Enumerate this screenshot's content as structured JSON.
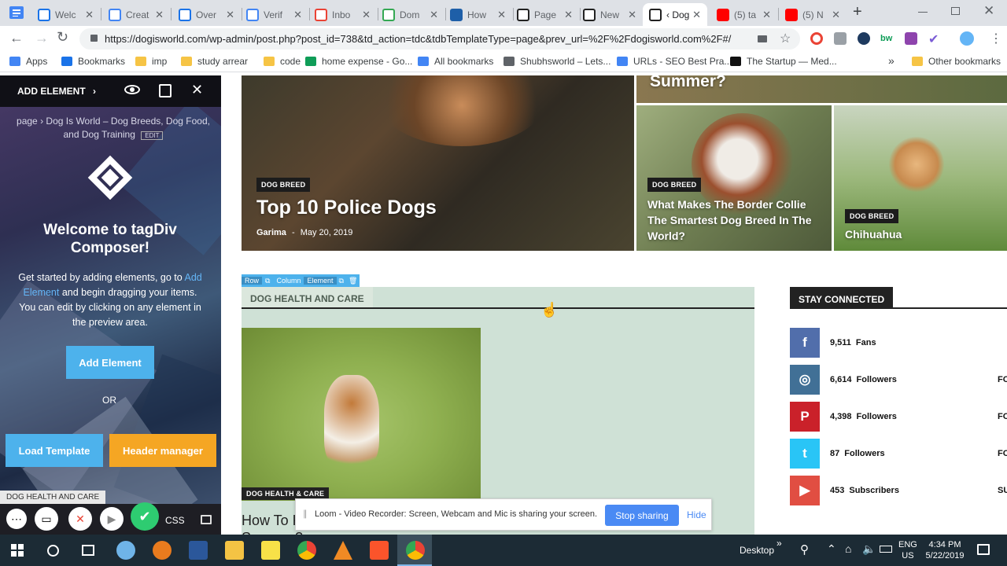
{
  "browser": {
    "tabs": [
      {
        "title": "Welc",
        "fav_color": "#ffffff",
        "fav_border": "#1a73e8",
        "icon": "wordpress-icon"
      },
      {
        "title": "Creat",
        "fav_color": "#ffffff",
        "fav_border": "#4285f4",
        "icon": "web-icon"
      },
      {
        "title": "Over",
        "fav_color": "#ffffff",
        "fav_border": "#1a73e8",
        "icon": "wordpress-icon"
      },
      {
        "title": "Verif",
        "fav_color": "#ffffff",
        "fav_border": "#4285f4",
        "icon": "google-icon"
      },
      {
        "title": "Inbo",
        "fav_color": "#ffffff",
        "fav_border": "#ea4335",
        "icon": "gmail-icon"
      },
      {
        "title": "Dom",
        "fav_color": "#ffffff",
        "fav_border": "#34a853",
        "icon": "domain-icon"
      },
      {
        "title": "How",
        "fav_color": "#1e5fa8",
        "fav_border": "#1e5fa8",
        "icon": "gear-icon"
      },
      {
        "title": "Page",
        "fav_color": "#ffffff",
        "fav_border": "#222222",
        "icon": "panda-icon"
      },
      {
        "title": "New",
        "fav_color": "#ffffff",
        "fav_border": "#222222",
        "icon": "tagdiv-icon"
      },
      {
        "title": "‹ Dog",
        "fav_color": "#ffffff",
        "fav_border": "#222222",
        "icon": "panda-icon",
        "active": true
      },
      {
        "title": "(5) ta",
        "fav_color": "#ff0000",
        "fav_border": "#ff0000",
        "icon": "youtube-icon"
      },
      {
        "title": "(5) N",
        "fav_color": "#ff0000",
        "fav_border": "#ff0000",
        "icon": "youtube-icon"
      }
    ],
    "new_tab": "+",
    "url": "https://dogisworld.com/wp-admin/post.php?post_id=738&td_action=tdc&tdbTemplateType=page&prev_url=%2F%2Fdogisworld.com%2F#/",
    "bookmarks": [
      {
        "label": "Apps",
        "color": "#4285f4"
      },
      {
        "label": "Bookmarks",
        "color": "#1a73e8"
      },
      {
        "label": "imp",
        "color": "#f6c445"
      },
      {
        "label": "study arrear",
        "color": "#f6c445"
      },
      {
        "label": "code",
        "color": "#f6c445"
      },
      {
        "label": "home expense - Go...",
        "color": "#0f9d58"
      },
      {
        "label": "All bookmarks",
        "color": "#4285f4"
      },
      {
        "label": "Shubhsworld – Lets...",
        "color": "#5f6368"
      },
      {
        "label": "URLs - SEO Best Pra...",
        "color": "#4285f4"
      },
      {
        "label": "The Startup — Med...",
        "color": "#111111"
      }
    ],
    "more": "»",
    "other_bookmarks": "Other bookmarks"
  },
  "sidebar": {
    "add_element": "ADD ELEMENT",
    "breadcrumb_page": "page",
    "breadcrumb_title": "Dog Is World – Dog Breeds, Dog Food, and Dog Training",
    "edit_label": "EDIT",
    "welcome": "Welcome to tagDiv Composer!",
    "intro_start": "Get started by adding elements, go to",
    "intro_link": "Add Element",
    "intro_end": "and begin dragging your items. You can edit by clicking on any element in the preview area.",
    "add_button": "Add Element",
    "or": "OR",
    "load_template": "Load Template",
    "header_manager": "Header manager",
    "status_label": "DOG HEALTH AND CARE",
    "css_label": "CSS"
  },
  "main": {
    "tile_top_right_title": "Summer?",
    "tile1": {
      "badge": "DOG BREED",
      "title": "Top 10 Police Dogs",
      "author": "Garima",
      "sep": "-",
      "date": "May 20, 2019"
    },
    "tile2": {
      "badge": "DOG BREED",
      "title": "What Makes The Border Collie The Smartest Dog Breed In The World?"
    },
    "tile3": {
      "badge": "DOG BREED",
      "title": "Chihuahua"
    },
    "editor_toolbar": {
      "row": "Row",
      "column": "Column",
      "element": "Element"
    },
    "section_title": "DOG HEALTH AND CARE",
    "post_badge": "DOG HEALTH & CARE",
    "post_title": "How To Keep Your Dog Cool in Summer?",
    "stay_connected": "STAY CONNECTED",
    "social": [
      {
        "icon": "facebook-icon",
        "glyph": "f",
        "color": "#516eab",
        "count": "9,511",
        "label": "Fans",
        "action": ""
      },
      {
        "icon": "instagram-icon",
        "glyph": "◎",
        "color": "#417096",
        "count": "6,614",
        "label": "Followers",
        "action": "FOL"
      },
      {
        "icon": "pinterest-icon",
        "glyph": "P",
        "color": "#ca212a",
        "count": "4,398",
        "label": "Followers",
        "action": "FOL"
      },
      {
        "icon": "twitter-icon",
        "glyph": "t",
        "color": "#29c5f6",
        "count": "87",
        "label": "Followers",
        "action": "FOL"
      },
      {
        "icon": "youtube-icon",
        "glyph": "▶",
        "color": "#e14e42",
        "count": "453",
        "label": "Subscribers",
        "action": "SUBSC"
      }
    ]
  },
  "loom": {
    "message": "Loom - Video Recorder: Screen, Webcam and Mic is sharing your screen.",
    "stop": "Stop sharing",
    "hide": "Hide"
  },
  "taskbar": {
    "desktop": "Desktop",
    "lang": "ENG",
    "region": "US",
    "time": "4:34 PM",
    "date": "5/22/2019"
  }
}
